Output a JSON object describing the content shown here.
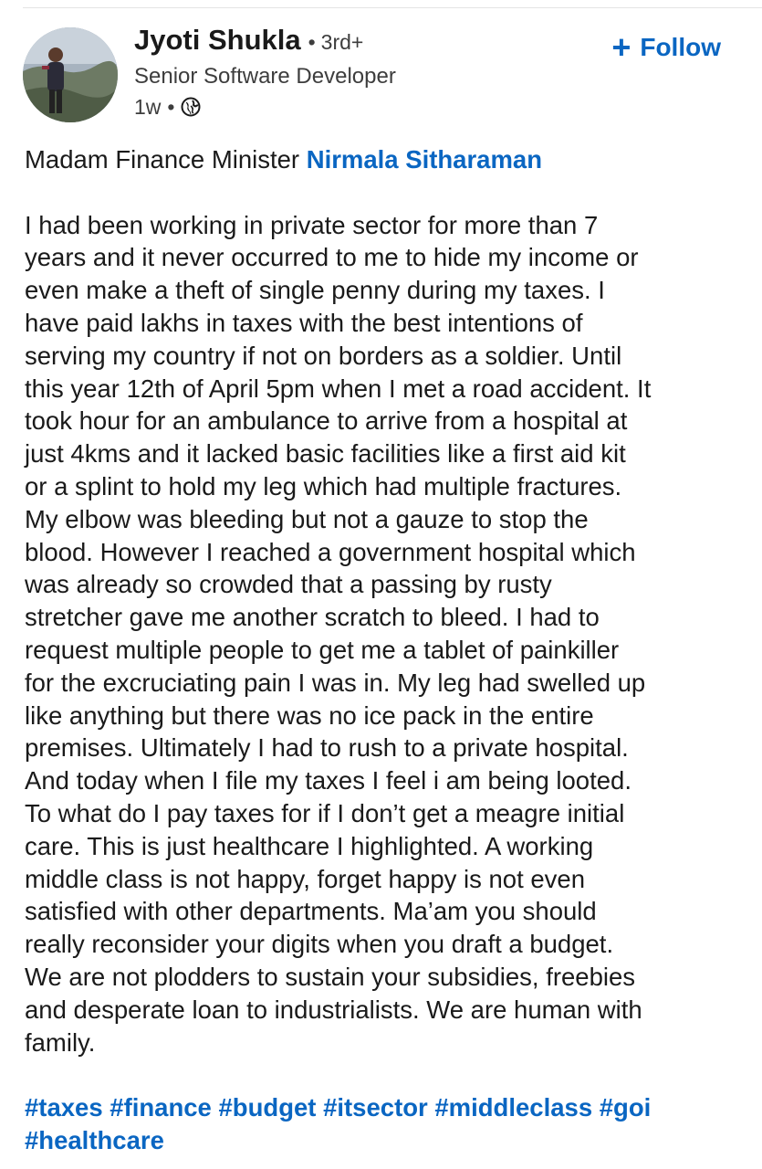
{
  "author": {
    "name": "Jyoti Shukla",
    "degree": "3rd+",
    "headline": "Senior Software Developer",
    "time": "1w",
    "visibility_icon": "globe-icon"
  },
  "follow_label": "Follow",
  "post": {
    "greeting_prefix": "Madam Finance Minister",
    "mention": "Nirmala Sitharaman",
    "body_lines": [
      "I had been working in private sector for more than 7",
      "years and it never occurred to me to hide my income or",
      "even make a theft of single penny during my taxes. I",
      "have paid lakhs in taxes with the best intentions of",
      "serving my country if not on borders as a soldier. Until",
      "this year 12th of April 5pm when I met a road accident. It",
      "took hour for an ambulance to arrive from a hospital at",
      "just 4kms and it lacked basic facilities like a first aid kit",
      "or a splint to hold my leg which had multiple fractures.",
      "My elbow was bleeding but not a gauze to stop the",
      "blood. However I reached a government hospital which",
      "was already so crowded that a passing by rusty",
      "stretcher gave me another scratch to bleed. I had to",
      "request multiple people to get me a tablet of painkiller",
      "for the excruciating pain I was in. My leg had swelled up",
      "like anything but there was no ice pack in the entire",
      "premises. Ultimately I had to rush to a private hospital.",
      "And today when I file my taxes I feel i am being looted.",
      "To what do I pay taxes for if I don’t get a meagre initial",
      "care. This is just healthcare I highlighted. A working",
      "middle class is not happy, forget happy is not even",
      "satisfied with other departments. Ma’am you should",
      "really reconsider your digits when you draft a budget.",
      "We are not plodders to sustain your subsidies, freebies",
      "and desperate loan to industrialists. We are human with",
      "family."
    ],
    "hashtags": [
      "#taxes",
      "#finance",
      "#budget",
      "#itsector",
      "#middleclass",
      "#goi",
      "#healthcare"
    ]
  },
  "colors": {
    "link": "#0a66c2",
    "text": "#1a1a1a",
    "secondary": "#3d3d3d"
  }
}
